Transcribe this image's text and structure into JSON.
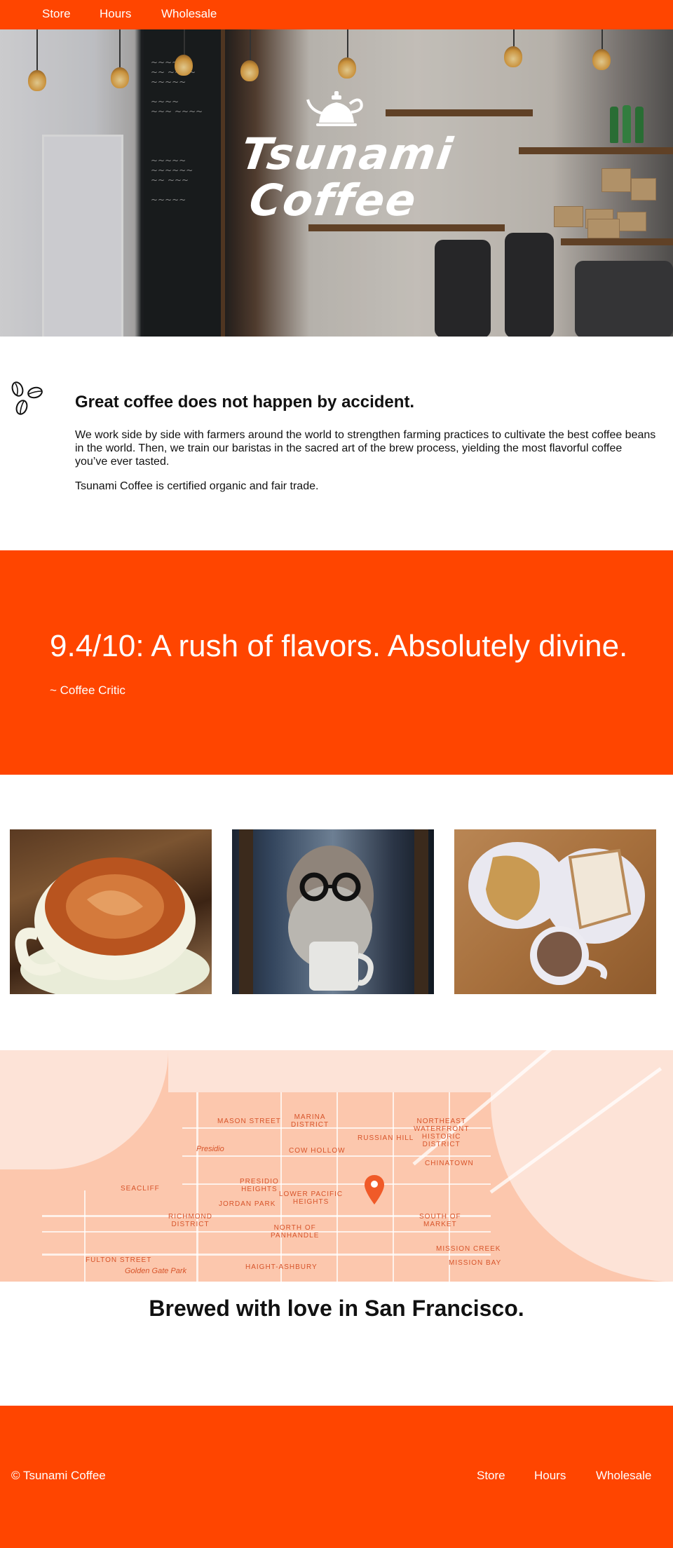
{
  "nav": {
    "items": [
      {
        "label": "Store"
      },
      {
        "label": "Hours"
      },
      {
        "label": "Wholesale"
      }
    ]
  },
  "hero": {
    "brand": "Tsunami Coffee",
    "logo_icon": "kettle-icon"
  },
  "intro": {
    "heading": "Great coffee does not happen by accident.",
    "paragraph": "We work side by side with farmers around the world to strengthen farming practices to cultivate the best coffee beans in the world. Then, we train our baristas in the sacred art of the brew process, yielding the most flavorful coffee you’ve ever tasted.",
    "certified": "Tsunami Coffee is certified organic and fair trade.",
    "icon": "coffee-beans-icon"
  },
  "quote": {
    "text": "9.4/10: A rush of flavors. Absolutely divine.",
    "attribution": "~ Coffee Critic"
  },
  "gallery": {
    "images": [
      {
        "name": "latte-photo"
      },
      {
        "name": "bearded-man-photo"
      },
      {
        "name": "breakfast-photo"
      }
    ]
  },
  "map": {
    "labels": {
      "marina": "MARINA\nDISTRICT",
      "northeast": "NORTHEAST\nWATERFRONT\nHISTORIC\nDISTRICT",
      "russian_hill": "RUSSIAN HILL",
      "presidio": "Presidio",
      "cow_hollow": "COW HOLLOW",
      "chinatown": "CHINATOWN",
      "seacliff": "SEACLIFF",
      "presidio_heights": "PRESIDIO\nHEIGHTS",
      "jordan_park": "JORDAN PARK",
      "lower_pacific": "LOWER PACIFIC\nHEIGHTS",
      "richmond": "RICHMOND\nDISTRICT",
      "north_panhandle": "NORTH OF\nPANHANDLE",
      "south_market": "SOUTH OF\nMARKET",
      "mission_creek": "MISSION CREEK",
      "mission_bay": "MISSION BAY",
      "fulton": "FULTON STREET",
      "golden_gate": "Golden Gate Park",
      "haight": "HAIGHT-ASHBURY",
      "mason": "MASON STREET"
    },
    "pin_color": "#f05a28"
  },
  "location": {
    "heading": "Brewed with love in San Francisco."
  },
  "footer": {
    "copyright": "© Tsunami Coffee",
    "links": [
      {
        "label": "Store"
      },
      {
        "label": "Hours"
      },
      {
        "label": "Wholesale"
      }
    ]
  },
  "colors": {
    "accent": "#ff4500",
    "map_bg": "#fcc7ad",
    "map_label": "#d7542a"
  }
}
